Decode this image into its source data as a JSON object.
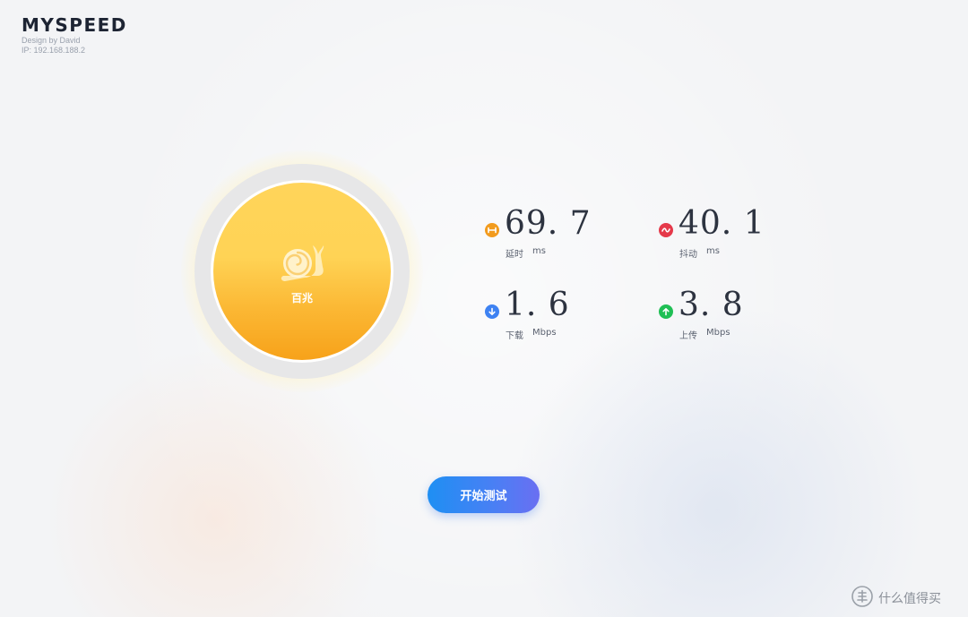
{
  "brand": {
    "title": "MYSPEED",
    "subtitle": "Design by David",
    "ip": "IP: 192.168.188.2"
  },
  "dial": {
    "icon": "snail-icon",
    "label": "百兆",
    "colors": {
      "top": "#ffd45a",
      "bottom": "#f7a21a",
      "ring": "#e7e7e8"
    }
  },
  "metrics": {
    "latency": {
      "value": "69. 7",
      "label": "延时",
      "unit": "ms",
      "icon": "latency-icon",
      "color": "#f29b1d"
    },
    "jitter": {
      "value": "40. 1",
      "label": "抖动",
      "unit": "ms",
      "icon": "jitter-icon",
      "color": "#e5394a"
    },
    "download": {
      "value": "1. 6",
      "label": "下载",
      "unit": "Mbps",
      "icon": "download-arrow-icon",
      "color": "#3e82f2"
    },
    "upload": {
      "value": "3. 8",
      "label": "上传",
      "unit": "Mbps",
      "icon": "upload-arrow-icon",
      "color": "#20bf55"
    }
  },
  "start_button": {
    "label": "开始测试",
    "color_start": "#1e8ff3",
    "color_end": "#6a6ff2"
  },
  "watermark": {
    "icon": "zhi-badge-icon",
    "text": "什么值得买"
  }
}
